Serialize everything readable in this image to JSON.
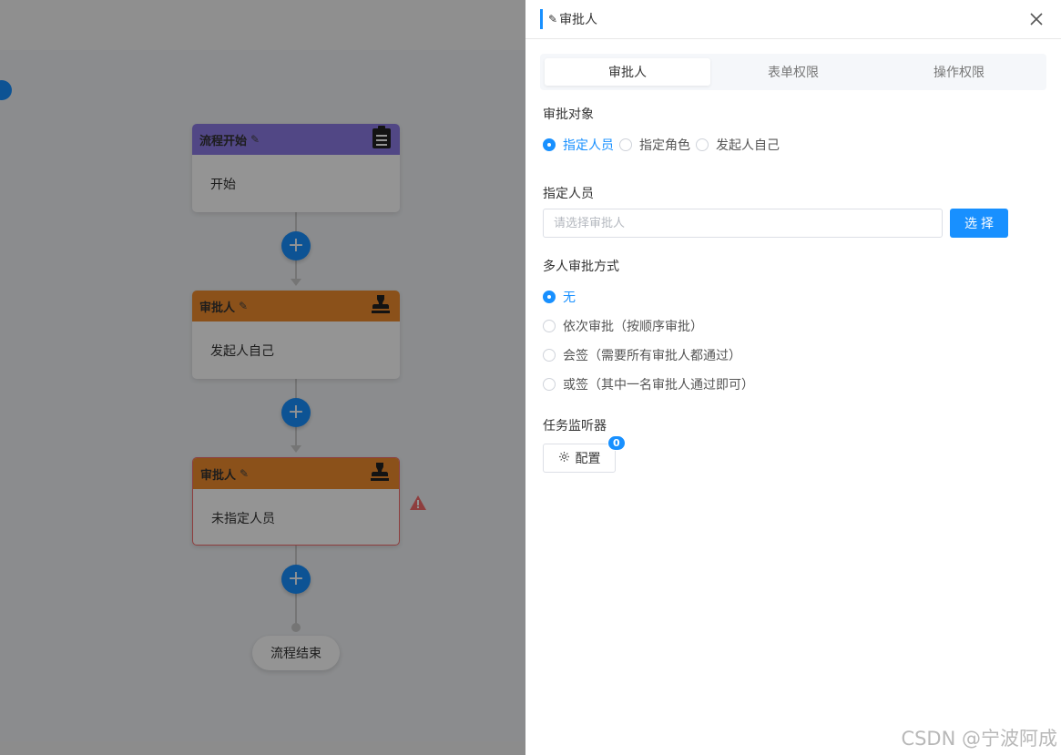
{
  "flow": {
    "start_node": {
      "title": "流程开始",
      "body": "开始"
    },
    "approver_node_1": {
      "title": "审批人",
      "body": "发起人自己"
    },
    "approver_node_2": {
      "title": "审批人",
      "body": "未指定人员"
    },
    "add_symbol": "+",
    "end_label": "流程结束"
  },
  "drawer": {
    "title": "审批人",
    "tabs": [
      {
        "label": "审批人",
        "active": true
      },
      {
        "label": "表单权限",
        "active": false
      },
      {
        "label": "操作权限",
        "active": false
      }
    ],
    "approval_target": {
      "label": "审批对象",
      "options": [
        {
          "label": "指定人员",
          "checked": true
        },
        {
          "label": "指定角色",
          "checked": false
        },
        {
          "label": "发起人自己",
          "checked": false
        }
      ]
    },
    "assignee": {
      "label": "指定人员",
      "placeholder": "请选择审批人",
      "value": "",
      "select_label": "选择"
    },
    "multi_mode": {
      "label": "多人审批方式",
      "options": [
        {
          "label": "无",
          "checked": true
        },
        {
          "label": "依次审批（按顺序审批）",
          "checked": false
        },
        {
          "label": "会签（需要所有审批人都通过）",
          "checked": false
        },
        {
          "label": "或签（其中一名审批人通过即可）",
          "checked": false
        }
      ]
    },
    "listener": {
      "label": "任务监听器",
      "button_label": "配置",
      "badge_count": "0"
    }
  },
  "watermark": "CSDN @宁波阿成",
  "colors": {
    "primary": "#1890ff",
    "start_header": "#8c7ae6",
    "approver_header": "#f08c2e",
    "error": "#f56c6c"
  }
}
